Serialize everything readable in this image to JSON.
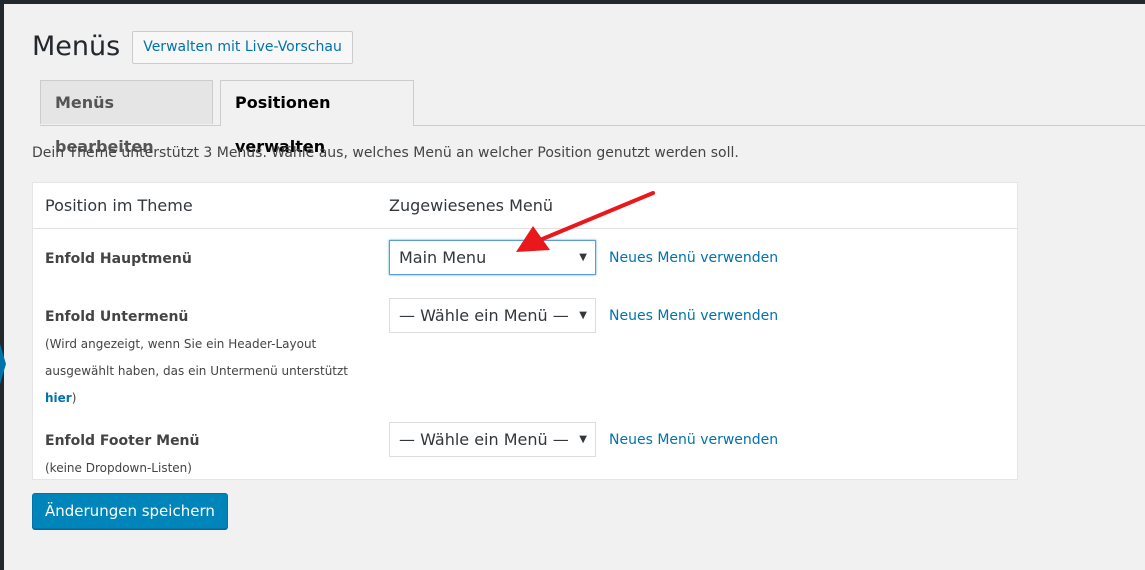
{
  "page": {
    "title": "Menüs",
    "live_preview_label": "Verwalten mit Live-Vorschau",
    "intro": "Dein Theme unterstützt 3 Menüs. Wähle aus, welches Menü an welcher Position genutzt werden soll.",
    "save_label": "Änderungen speichern"
  },
  "tabs": [
    {
      "label": "Menüs bearbeiten",
      "active": false
    },
    {
      "label": "Positionen verwalten",
      "active": true
    }
  ],
  "table": {
    "col_position": "Position im Theme",
    "col_menu": "Zugewiesenes Menü"
  },
  "locations": [
    {
      "title": "Enfold Hauptmenü",
      "selected": "Main Menu",
      "link": "Neues Menü verwenden"
    },
    {
      "title": "Enfold Untermenü",
      "desc_before": "(Wird angezeigt, wenn Sie ein Header-Layout ausgewählt haben, das ein Untermenü unterstützt ",
      "desc_link": "hier",
      "desc_after": ")",
      "selected": "— Wähle ein Menü —",
      "link": "Neues Menü verwenden"
    },
    {
      "title": "Enfold Footer Menü",
      "desc_before": "(keine Dropdown-Listen)",
      "selected": "— Wähle ein Menü —",
      "link": "Neues Menü verwenden"
    }
  ],
  "colors": {
    "accent": "#0073aa",
    "button": "#0085ba",
    "annotation_arrow": "#e8181b"
  }
}
